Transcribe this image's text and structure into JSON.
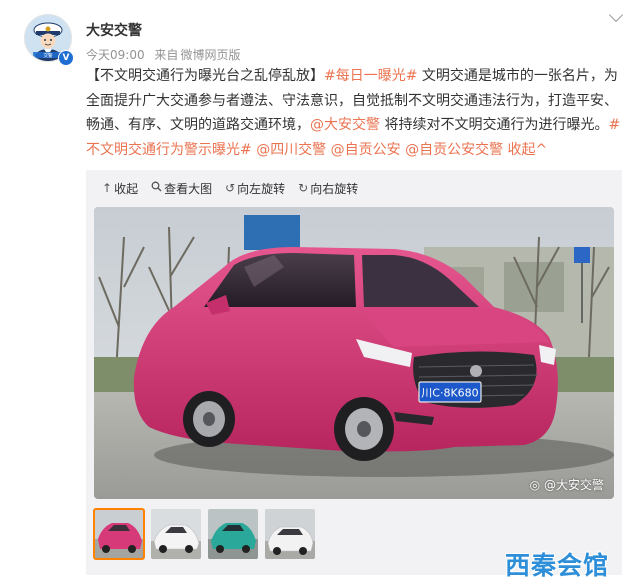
{
  "post": {
    "author": "大安交警",
    "verified_badge": "V",
    "avatar_text": "交警",
    "time": "今天09:00",
    "source_prefix": "来自",
    "source": "微博网页版",
    "text_segments": [
      {
        "text": "【不文明交通行为曝光台之乱停乱放】",
        "style": "normal"
      },
      {
        "text": "#每日一曝光#",
        "style": "orange"
      },
      {
        "text": " 文明交通是城市的一张名片，为全面提升广大交通参与者遵法、守法意识，自觉抵制不文明交通违法行为，打造平安、畅通、有序、文明的道路交通环境，",
        "style": "normal"
      },
      {
        "text": "@大安交警",
        "style": "orange"
      },
      {
        "text": " 将持续对不文明交通行为进行曝光。",
        "style": "normal"
      },
      {
        "text": "#不文明交通行为警示曝光#",
        "style": "orange"
      },
      {
        "text": " ",
        "style": "normal"
      },
      {
        "text": "@四川交警",
        "style": "orange"
      },
      {
        "text": " ",
        "style": "normal"
      },
      {
        "text": "@自贡公安",
        "style": "orange"
      },
      {
        "text": " ",
        "style": "normal"
      },
      {
        "text": "@自贡公安交警",
        "style": "orange"
      },
      {
        "text": " ",
        "style": "normal"
      },
      {
        "text": "收起^",
        "style": "orange"
      }
    ]
  },
  "toolbar": {
    "collapse_icon": "↑",
    "collapse_label": "收起",
    "view_icon": "search-icon",
    "view_label": "查看大图",
    "rotate_left_icon": "↺",
    "rotate_left_label": "向左旋转",
    "rotate_right_icon": "↻",
    "rotate_right_label": "向右旋转"
  },
  "photo": {
    "plate": "川C·8K680",
    "watermark": "@大安交警",
    "watermark_icon": "weibo-icon"
  },
  "thumbnails": [
    {
      "label": "pink-car",
      "car_color": "#d63a78",
      "active": true
    },
    {
      "label": "white-car-1",
      "car_color": "#f4f4f4",
      "active": false
    },
    {
      "label": "teal-car",
      "car_color": "#2aa99a",
      "active": false
    },
    {
      "label": "white-car-2",
      "car_color": "#f2f2f2",
      "active": false
    }
  ],
  "site_logo": "西秦会馆",
  "colors": {
    "link_orange": "#eb7350",
    "active_thumb": "#ff8200",
    "logo_blue": "#2e8fd8"
  }
}
